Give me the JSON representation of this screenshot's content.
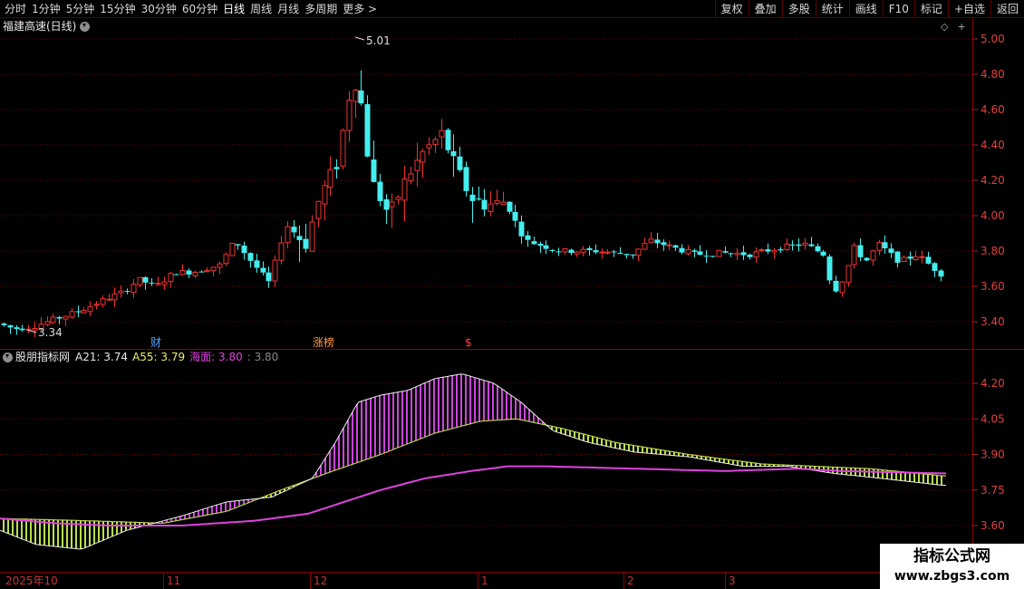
{
  "toolbar": {
    "periods": [
      "分时",
      "1分钟",
      "5分钟",
      "15分钟",
      "30分钟",
      "60分钟",
      "日线",
      "周线",
      "月线",
      "多周期",
      "更多 >"
    ],
    "active_period": "日线",
    "buttons": [
      "复权",
      "叠加",
      "多股",
      "统计",
      "画线",
      "F10",
      "标记",
      "+自选",
      "返回"
    ]
  },
  "main_pane": {
    "title": "福建高速(日线)",
    "price_axis": [
      "5.00",
      "4.80",
      "4.60",
      "4.40",
      "4.20",
      "4.00",
      "3.80",
      "3.60",
      "3.40"
    ],
    "high_label": "5.01",
    "low_label": "3.34",
    "markers": [
      {
        "text": "财",
        "color": "#4ea6ff"
      },
      {
        "text": "涨榜",
        "color": "#ff9a3c"
      },
      {
        "text": "$",
        "color": "#ff4040"
      }
    ]
  },
  "indicator_pane": {
    "name": "股朋指标网",
    "values": [
      {
        "label": "A21: 3.74",
        "color": "#e6e6e6"
      },
      {
        "label": "A55: 3.79",
        "color": "#eeee66"
      },
      {
        "label": "海面: 3.80",
        "color": "#dd44dd"
      },
      {
        "label": ": 3.80",
        "color": "#888888"
      }
    ],
    "axis": [
      "4.20",
      "4.05",
      "3.90",
      "3.75",
      "3.60"
    ]
  },
  "date_axis": [
    "2025年10",
    "11",
    "12",
    "1",
    "2",
    "3"
  ],
  "colors": {
    "up": "#ee3333",
    "down": "#44eeee",
    "magenta": "#cc44dd",
    "lime": "#b8e04a",
    "grid": "#7a0000"
  },
  "watermark": {
    "title": "指标公式网",
    "url": "www.zbgs3.com"
  }
}
